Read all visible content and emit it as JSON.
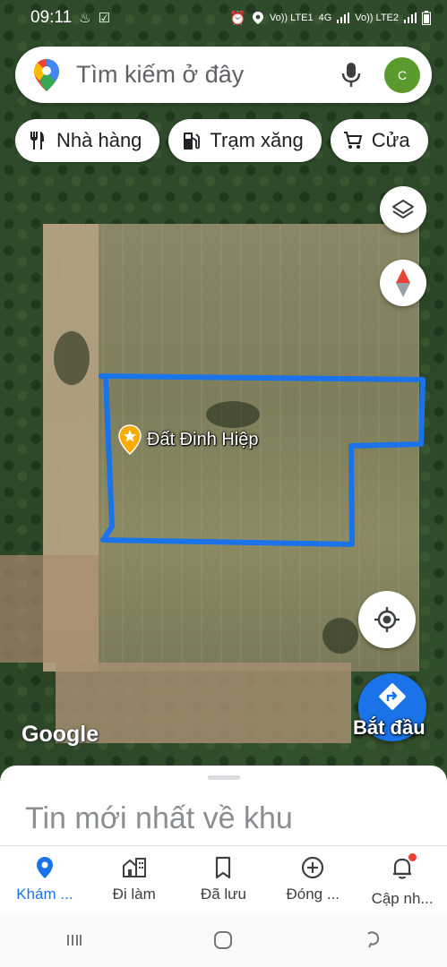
{
  "status_bar": {
    "time": "09:11",
    "network_label": "Vo)) LTE1",
    "network_label_2": "4G",
    "network_label_3": "Vo)) LTE2"
  },
  "search": {
    "placeholder": "Tìm kiếm ở đây",
    "avatar_letter": "C"
  },
  "chips": [
    {
      "label": "Nhà hàng",
      "icon": "restaurant-icon"
    },
    {
      "label": "Trạm xăng",
      "icon": "gas-station-icon"
    },
    {
      "label": "Cửa",
      "icon": "shopping-cart-icon"
    }
  ],
  "map": {
    "place_label": "Đất Đinh Hiệp",
    "attribution": "Google",
    "start_label": "Bắt đầu",
    "parcel_outline_color": "#1a73e8"
  },
  "sheet": {
    "title": "Tin mới nhất về khu"
  },
  "bottom_nav": [
    {
      "label": "Khám ...",
      "icon": "explore-pin-icon",
      "active": true
    },
    {
      "label": "Đi làm",
      "icon": "commute-icon",
      "active": false
    },
    {
      "label": "Đã lưu",
      "icon": "bookmark-icon",
      "active": false
    },
    {
      "label": "Đóng ...",
      "icon": "add-circle-icon",
      "active": false
    },
    {
      "label": "Cập nh...",
      "icon": "bell-icon",
      "active": false
    }
  ],
  "colors": {
    "accent": "#1a73e8",
    "avatar": "#5b9a2c",
    "notification_dot": "#ea4335"
  }
}
